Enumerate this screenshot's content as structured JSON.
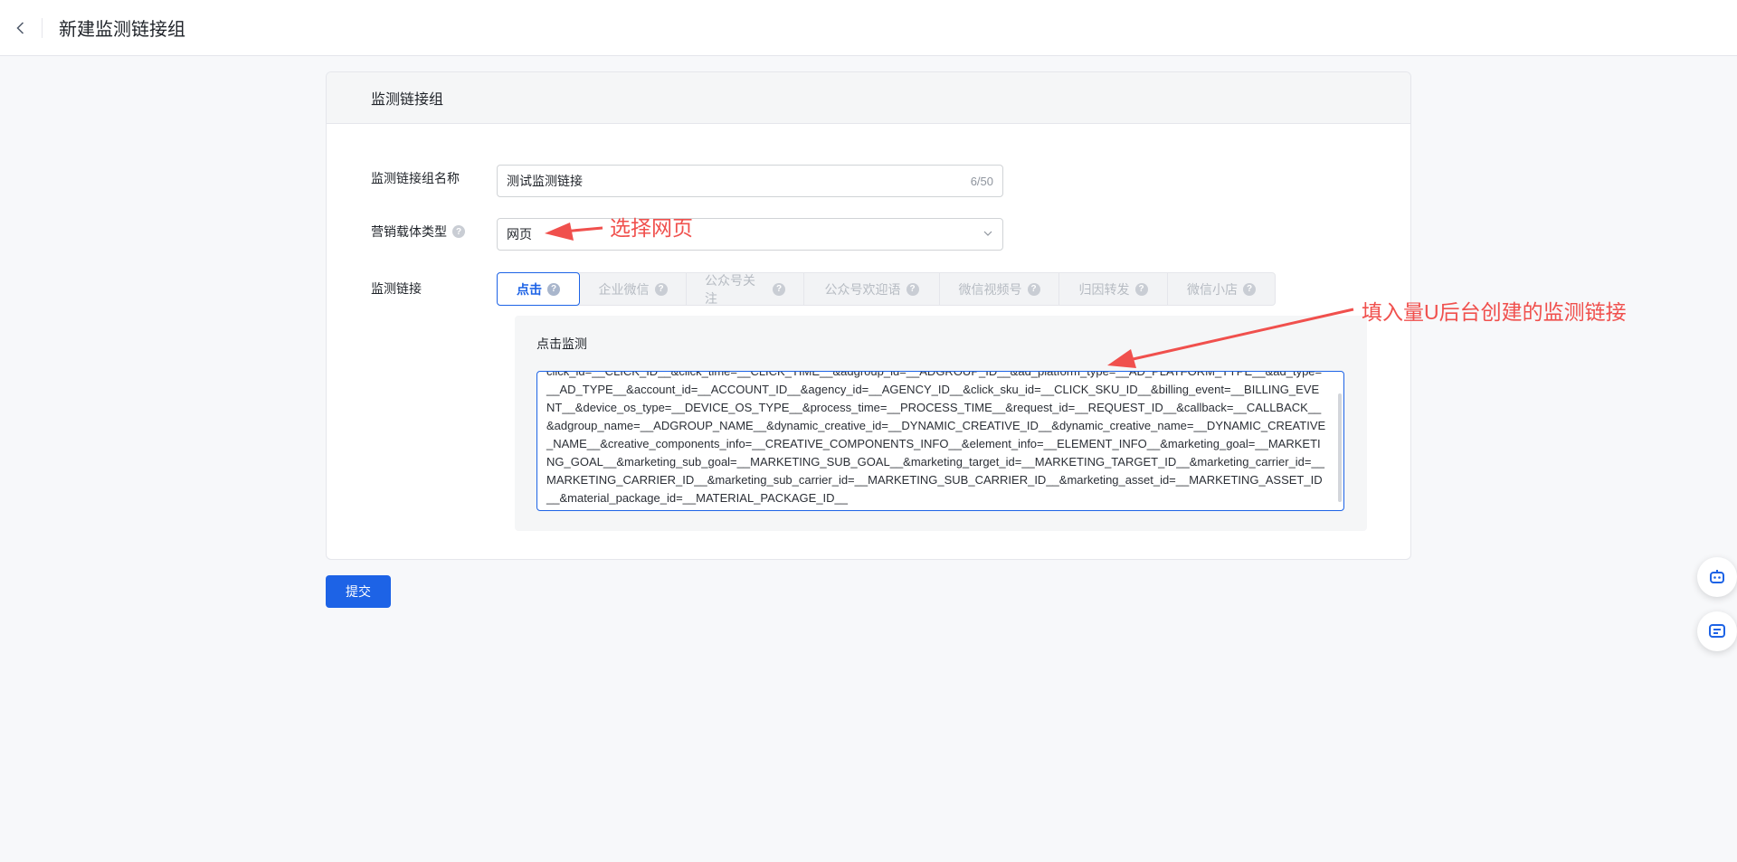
{
  "header": {
    "title": "新建监测链接组"
  },
  "card": {
    "title": "监测链接组",
    "name_field": {
      "label": "监测链接组名称",
      "value": "测试监测链接",
      "counter": "6/50"
    },
    "carrier_field": {
      "label": "营销载体类型",
      "value": "网页"
    },
    "link_field": {
      "label": "监测链接"
    },
    "tabs": [
      {
        "label": "点击",
        "active": true
      },
      {
        "label": "企业微信",
        "active": false
      },
      {
        "label": "公众号关注",
        "active": false
      },
      {
        "label": "公众号欢迎语",
        "active": false
      },
      {
        "label": "微信视频号",
        "active": false
      },
      {
        "label": "归因转发",
        "active": false
      },
      {
        "label": "微信小店",
        "active": false
      }
    ],
    "monitor": {
      "title": "点击监测",
      "url": "click_id=__CLICK_ID__&click_time=__CLICK_TIME__&adgroup_id=__ADGROUP_ID__&ad_platform_type=__AD_PLATFORM_TYPE__&ad_type=__AD_TYPE__&account_id=__ACCOUNT_ID__&agency_id=__AGENCY_ID__&click_sku_id=__CLICK_SKU_ID__&billing_event=__BILLING_EVENT__&device_os_type=__DEVICE_OS_TYPE__&process_time=__PROCESS_TIME__&request_id=__REQUEST_ID__&callback=__CALLBACK__&adgroup_name=__ADGROUP_NAME__&dynamic_creative_id=__DYNAMIC_CREATIVE_ID__&dynamic_creative_name=__DYNAMIC_CREATIVE_NAME__&creative_components_info=__CREATIVE_COMPONENTS_INFO__&element_info=__ELEMENT_INFO__&marketing_goal=__MARKETING_GOAL__&marketing_sub_goal=__MARKETING_SUB_GOAL__&marketing_target_id=__MARKETING_TARGET_ID__&marketing_carrier_id=__MARKETING_CARRIER_ID__&marketing_sub_carrier_id=__MARKETING_SUB_CARRIER_ID__&marketing_asset_id=__MARKETING_ASSET_ID__&material_package_id=__MATERIAL_PACKAGE_ID__"
    }
  },
  "submit_label": "提交",
  "annotations": {
    "select_page": "选择网页",
    "fill_link": "填入量U后台创建的监测链接"
  },
  "colors": {
    "primary": "#1d63e6",
    "annotation": "#f0504d"
  }
}
